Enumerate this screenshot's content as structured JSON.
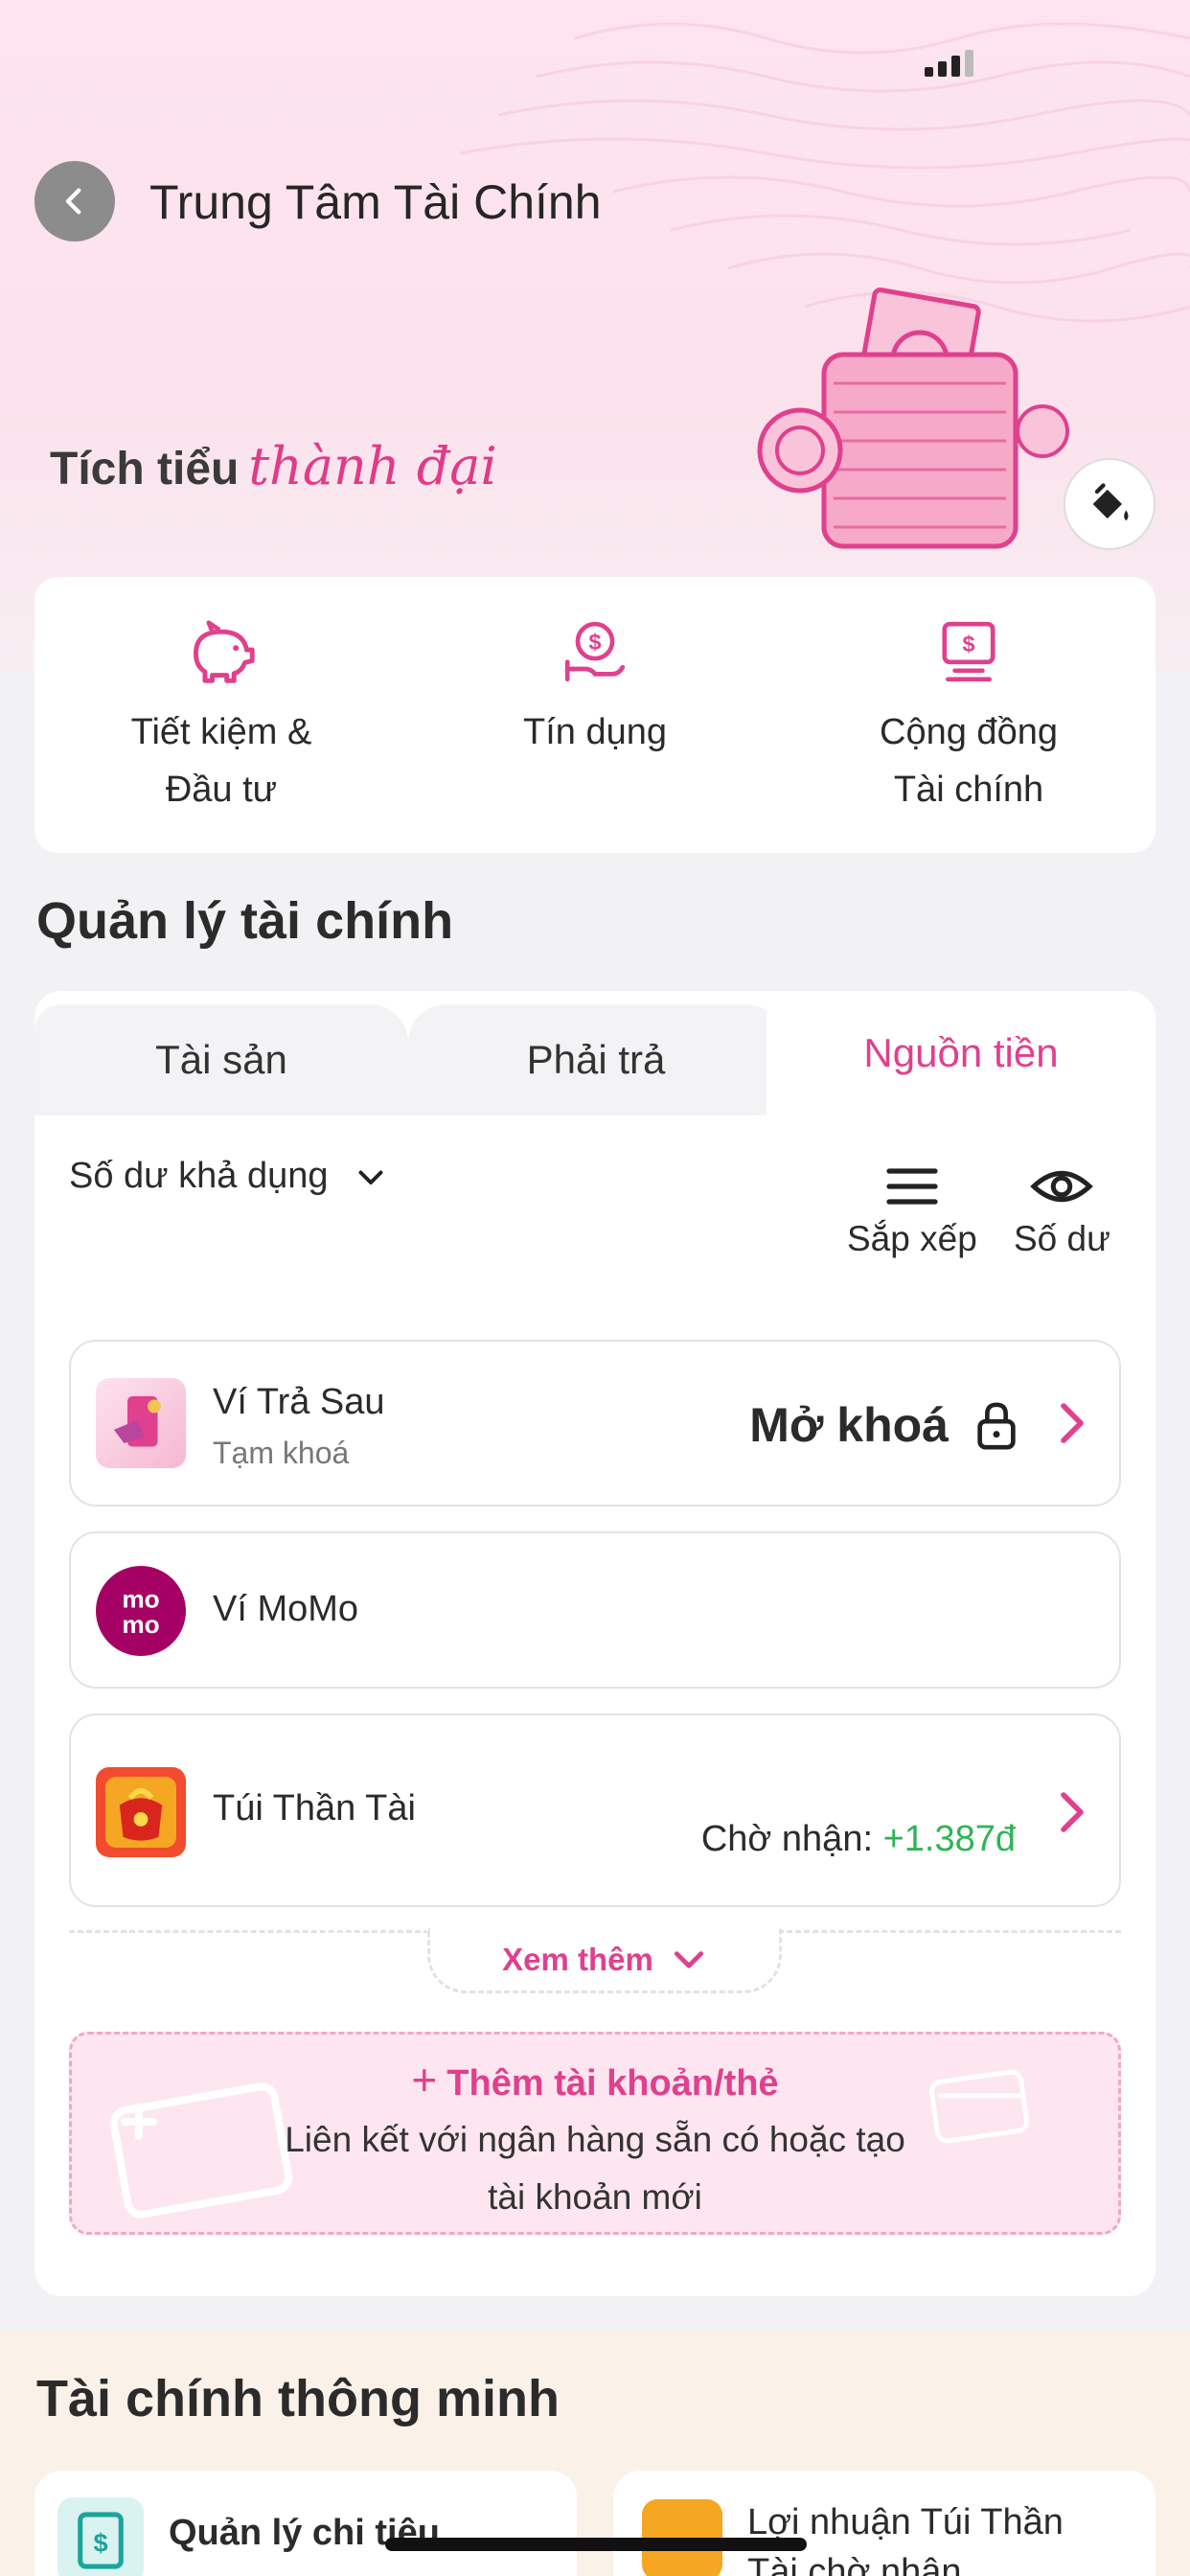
{
  "header": {
    "title": "Trung Tâm Tài Chính"
  },
  "banner": {
    "slogan_plain": "Tích tiểu",
    "slogan_script": "thành đại"
  },
  "quick_actions": [
    {
      "label": "Tiết kiệm &\nĐầu tư",
      "icon": "piggy-bank-icon"
    },
    {
      "label": "Tín dụng",
      "icon": "coin-hand-icon"
    },
    {
      "label": "Cộng đồng\nTài chính",
      "icon": "monitor-dollar-icon"
    }
  ],
  "manage": {
    "section_title": "Quản lý tài chính",
    "tabs": [
      "Tài sản",
      "Phải trả",
      "Nguồn tiền"
    ],
    "active_tab": 2,
    "balance_selector": "Số dư khả dụng",
    "sort_label": "Sắp xếp",
    "balance_toggle_label": "Số dư",
    "accounts": [
      {
        "name": "Ví Trả Sau",
        "sub": "Tạm khoá",
        "action": "Mở khoá"
      },
      {
        "name": "Ví MoMo",
        "logo_text": "mo\nmo"
      },
      {
        "name": "Túi Thần Tài",
        "pending_label": "Chờ nhận:",
        "pending_amount": "+1.387đ"
      }
    ],
    "see_more": "Xem thêm",
    "add_account": {
      "title": "Thêm tài khoản/thẻ",
      "desc": "Liên kết với ngân hàng sẵn có hoặc tạo\ntài khoản mới"
    }
  },
  "smart_finance": {
    "title": "Tài chính thông minh",
    "cards": [
      {
        "label": "Quản lý chi tiêu"
      },
      {
        "label": "Lợi nhuận Túi Thần\nTài chờ nhận"
      }
    ]
  },
  "colors": {
    "accent": "#e0408d",
    "positive": "#2fb457",
    "momo": "#a50064"
  }
}
